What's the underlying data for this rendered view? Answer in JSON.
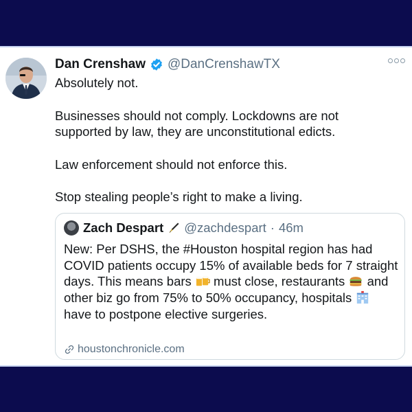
{
  "tweet": {
    "author_name": "Dan Crenshaw",
    "author_handle": "@DanCrenshawTX",
    "paragraphs": [
      "Absolutely not.",
      "Businesses should not comply. Lockdowns are not supported by law, they are unconstitutional edicts.",
      "Law enforcement should not enforce this.",
      "Stop stealing people’s right to make a living."
    ]
  },
  "quoted": {
    "author_name": "Zach Despart",
    "author_handle": "@zachdespart",
    "separator": "·",
    "time": "46m",
    "text_parts": [
      "New: Per DSHS, the #Houston hospital region has had COVID patients occupy 15% of available beds for 7 straight days. This means bars ",
      " must close, restaurants ",
      " and other biz go from 75% to 50% occupancy, hospitals ",
      " have to postpone elective surgeries."
    ],
    "emojis": [
      "beer-mugs-icon",
      "hamburger-icon",
      "hospital-icon"
    ],
    "link_text": "houstonchronicle.com"
  },
  "colors": {
    "frame_background": "#0c0c4e",
    "verified_blue": "#1da1f2",
    "secondary_text": "#5b7083"
  }
}
